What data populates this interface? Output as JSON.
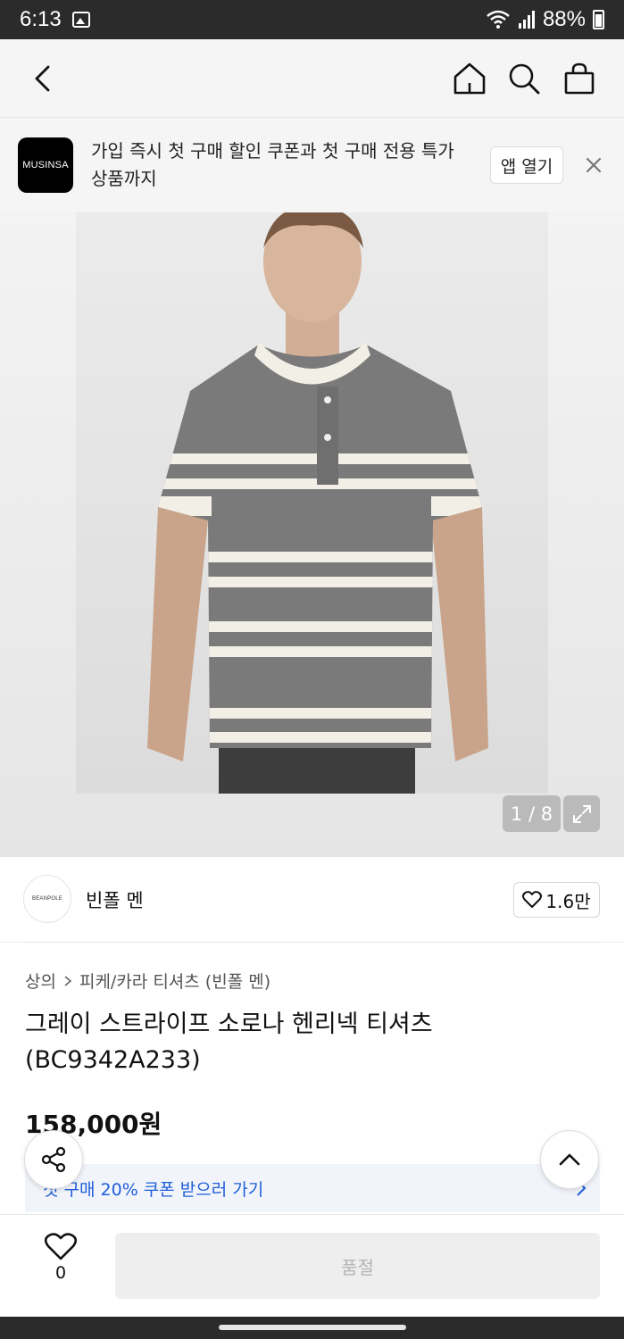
{
  "status_bar": {
    "time": "6:13",
    "battery": "88%"
  },
  "nav": {
    "icons": [
      "back-icon",
      "home-icon",
      "search-icon",
      "bag-icon"
    ]
  },
  "banner": {
    "logo_text": "MUSINSA",
    "message": "가입 즉시 첫 구매 할인 쿠폰과 첫 구매 전용 특가 상품까지",
    "open_label": "앱 열기"
  },
  "gallery": {
    "indicator": "1 / 8"
  },
  "brand": {
    "avatar_text": "BEANPOLE",
    "name": "빈폴 멘",
    "likes": "1.6만"
  },
  "product": {
    "breadcrumb": [
      "상의",
      "피케/카라 티셔츠 (빈폴 멘)"
    ],
    "title": "그레이 스트라이프 소로나 헨리넥 티셔츠 (BC9342A233)",
    "price": "158,000원"
  },
  "coupon": {
    "text": "첫 구매 20% 쿠폰 받으러 가기"
  },
  "bottom_bar": {
    "wish_count": "0",
    "buy_label": "품절"
  },
  "colors": {
    "accent_blue": "#1f5ed9",
    "shirt_gray": "#7a7a7a",
    "stripe": "#f2efe6"
  }
}
